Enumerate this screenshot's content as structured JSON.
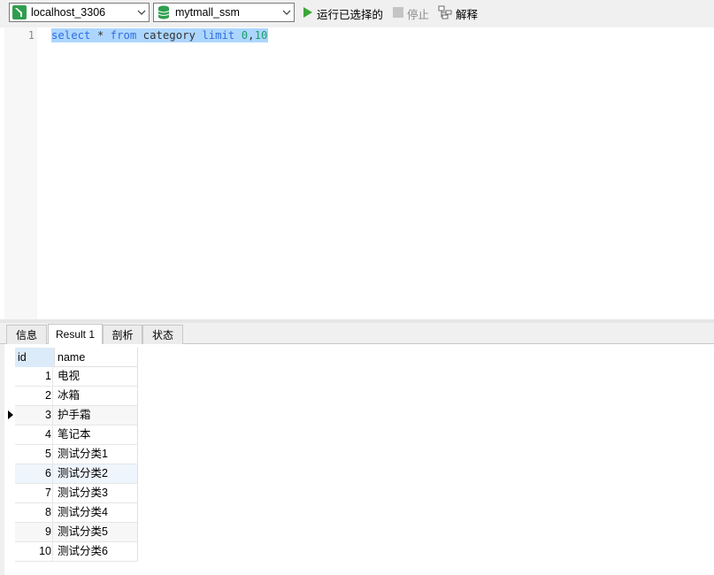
{
  "toolbar": {
    "connection": "localhost_3306",
    "database": "mytmall_ssm",
    "run_selected_label": "运行已选择的",
    "stop_label": "停止",
    "explain_label": "解释"
  },
  "editor": {
    "line_number": "1",
    "tokens": {
      "select": "select",
      "star": "*",
      "from": "from",
      "table": "category",
      "limit": "limit",
      "offset": "0",
      "comma": ",",
      "count": "10"
    }
  },
  "tabs": [
    {
      "label": "信息"
    },
    {
      "label": "Result 1"
    },
    {
      "label": "剖析"
    },
    {
      "label": "状态"
    }
  ],
  "grid": {
    "columns": [
      "id",
      "name"
    ],
    "rows": [
      {
        "id": "1",
        "name": "电视"
      },
      {
        "id": "2",
        "name": "冰箱"
      },
      {
        "id": "3",
        "name": "护手霜"
      },
      {
        "id": "4",
        "name": "笔记本"
      },
      {
        "id": "5",
        "name": "测试分类1"
      },
      {
        "id": "6",
        "name": "测试分类2"
      },
      {
        "id": "7",
        "name": "测试分类3"
      },
      {
        "id": "8",
        "name": "测试分类4"
      },
      {
        "id": "9",
        "name": "测试分类5"
      },
      {
        "id": "10",
        "name": "测试分类6"
      }
    ]
  },
  "icons": {
    "connection": "mysql-connection-icon",
    "database": "database-icon",
    "run": "play-icon",
    "stop": "stop-icon",
    "explain": "explain-icon"
  },
  "colors": {
    "keyword": "#2f6fdf",
    "number": "#1a9e6e",
    "selection": "#add6ff",
    "run_icon": "#3aa63a",
    "db_icon": "#2e9e4e"
  }
}
